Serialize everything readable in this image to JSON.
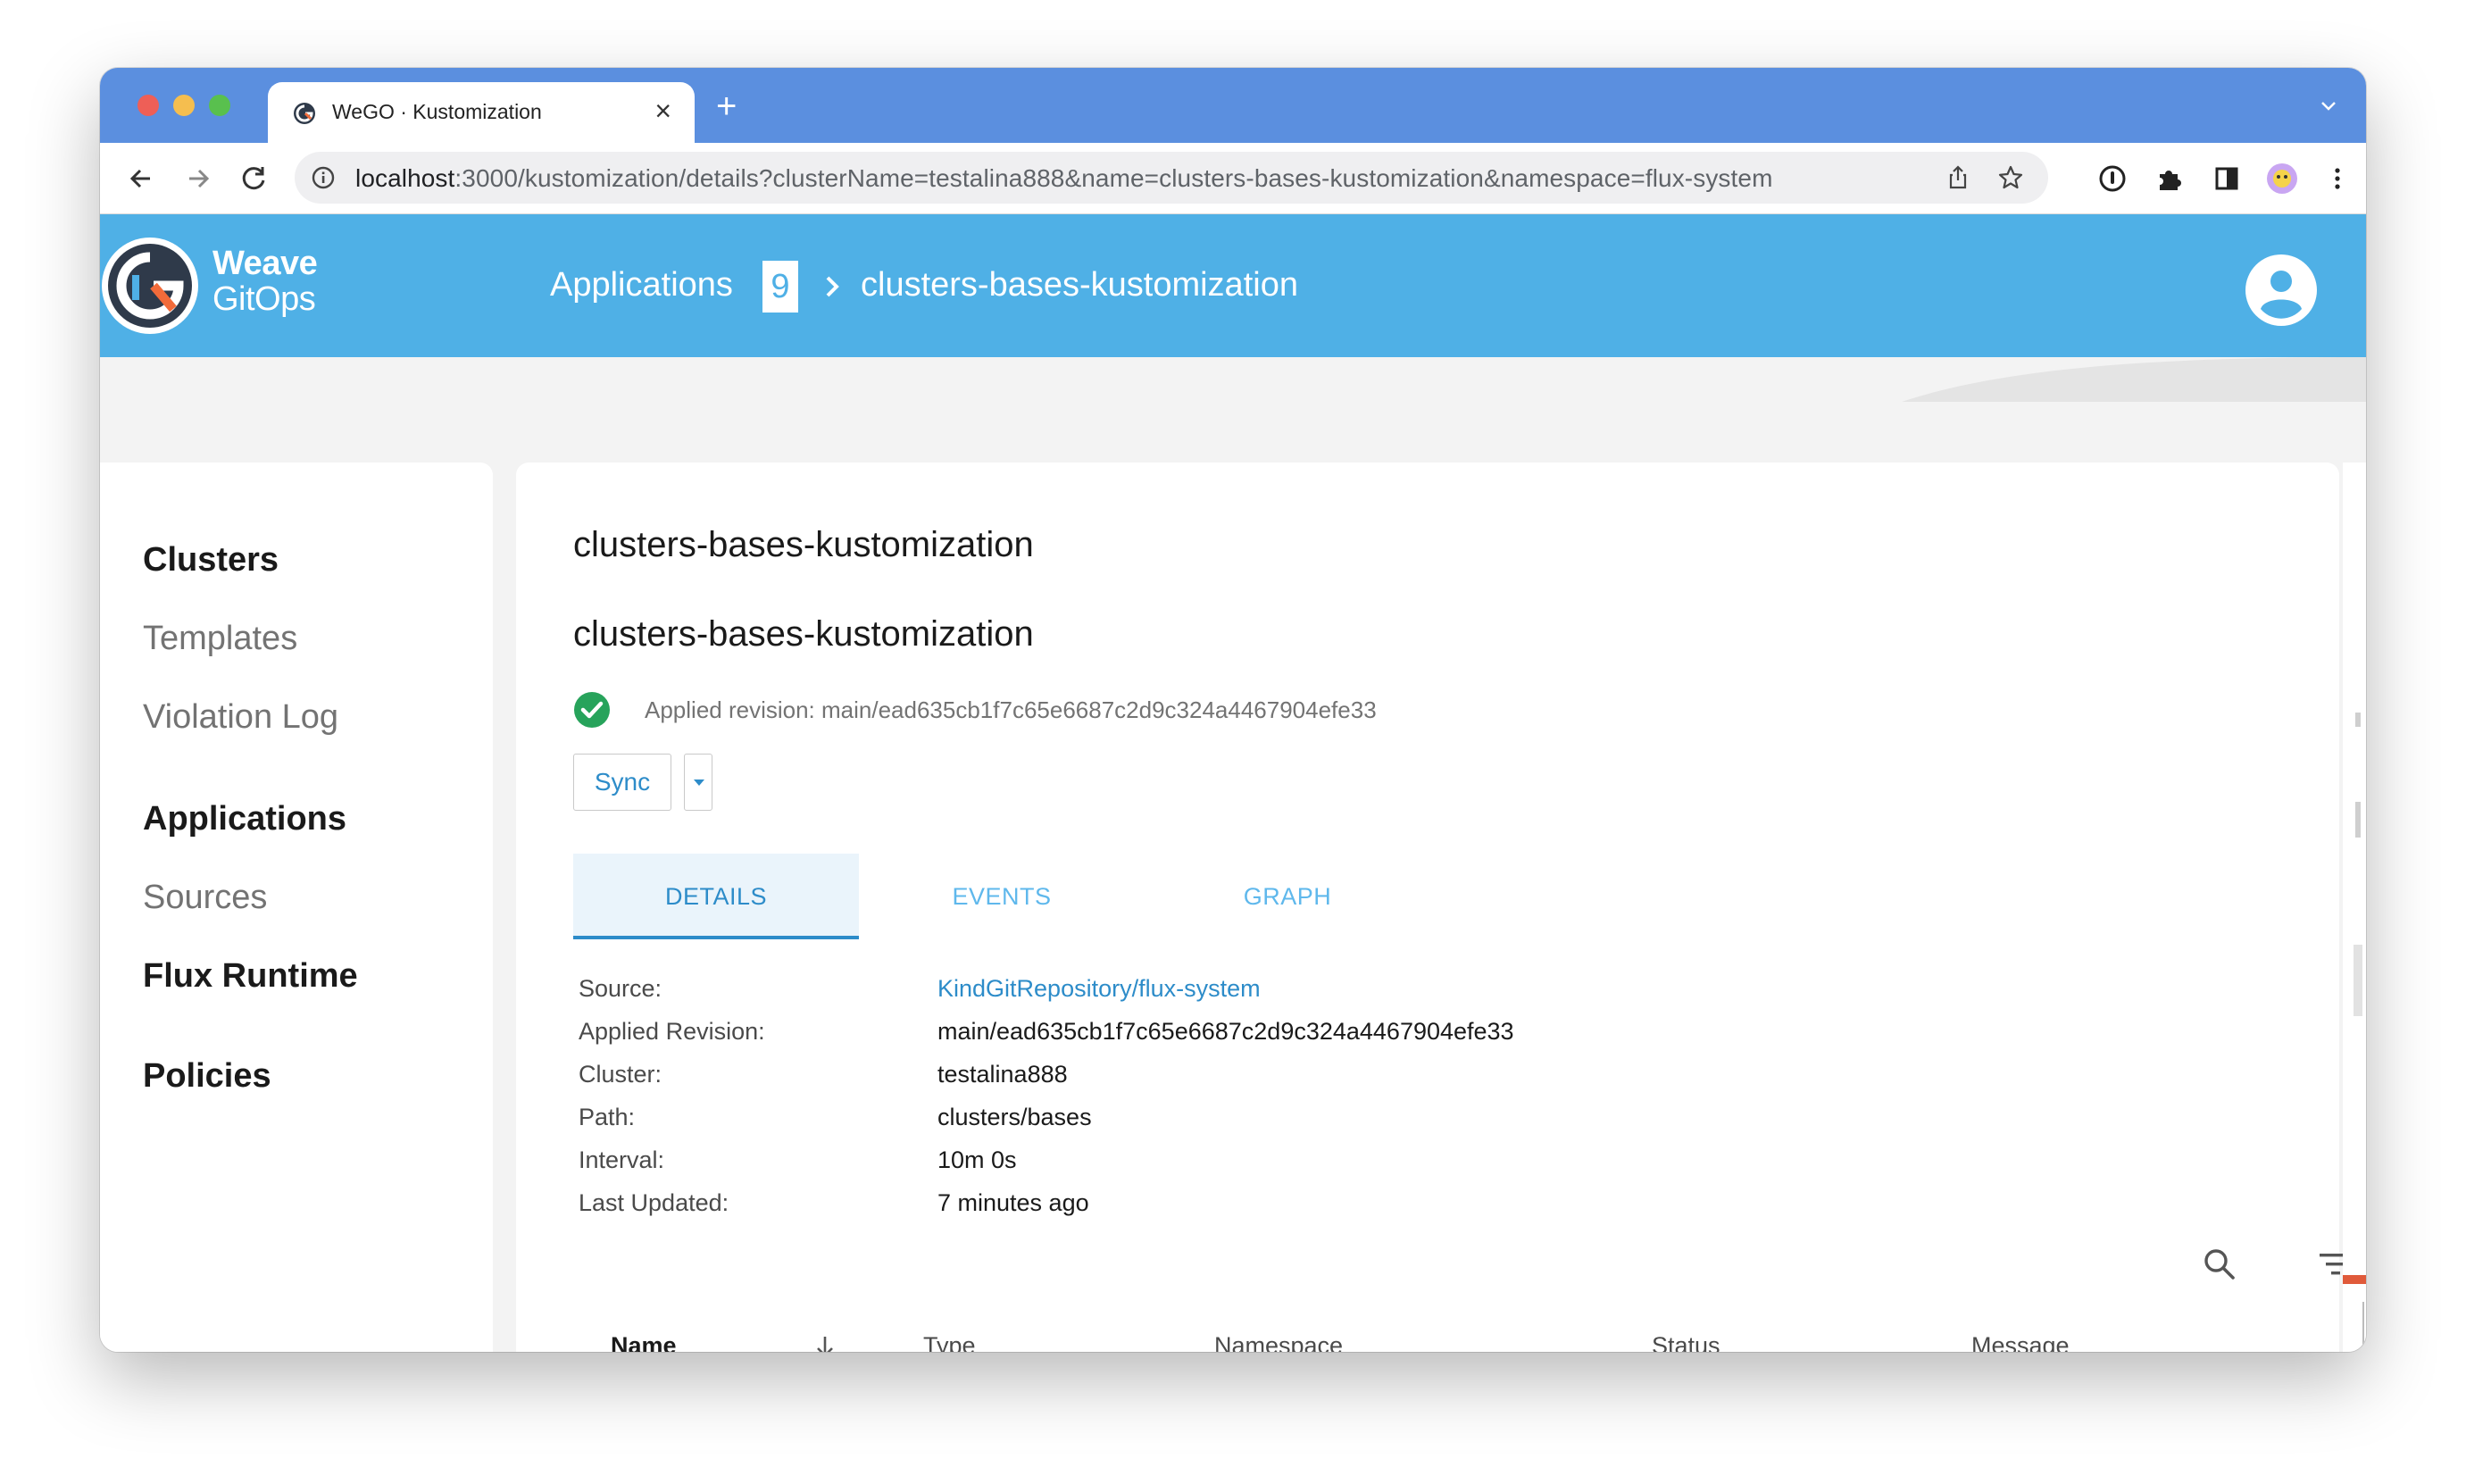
{
  "browser": {
    "tab_title": "WeGO · Kustomization",
    "url_host": "localhost",
    "url_rest": ":3000/kustomization/details?clusterName=testalina888&name=clusters-bases-kustomization&namespace=flux-system"
  },
  "header": {
    "logo_line1": "Weave",
    "logo_line2": "GitOps",
    "breadcrumb_parent": "Applications",
    "breadcrumb_count": "9",
    "breadcrumb_current": "clusters-bases-kustomization"
  },
  "sidebar": {
    "items": [
      {
        "label": "Clusters"
      },
      {
        "label": "Templates"
      },
      {
        "label": "Violation Log"
      },
      {
        "label": "Applications"
      },
      {
        "label": "Sources"
      },
      {
        "label": "Flux Runtime"
      },
      {
        "label": "Policies"
      }
    ]
  },
  "main": {
    "title": "clusters-bases-kustomization",
    "subtitle": "clusters-bases-kustomization",
    "status_text": "Applied revision: main/ead635cb1f7c65e6687c2d9c324a4467904efe33",
    "sync_label": "Sync",
    "tabs": [
      {
        "label": "DETAILS"
      },
      {
        "label": "EVENTS"
      },
      {
        "label": "GRAPH"
      }
    ],
    "details": [
      {
        "label": "Source:",
        "value": "KindGitRepository/flux-system"
      },
      {
        "label": "Applied Revision:",
        "value": "main/ead635cb1f7c65e6687c2d9c324a4467904efe33"
      },
      {
        "label": "Cluster:",
        "value": "testalina888"
      },
      {
        "label": "Path:",
        "value": "clusters/bases"
      },
      {
        "label": "Interval:",
        "value": "10m 0s"
      },
      {
        "label": "Last Updated:",
        "value": "7 minutes ago"
      }
    ],
    "table_columns": [
      {
        "label": "Name"
      },
      {
        "label": "Type"
      },
      {
        "label": "Namespace"
      },
      {
        "label": "Status"
      },
      {
        "label": "Message"
      }
    ]
  },
  "colors": {
    "header": "#4fb0e6",
    "tabstrip": "#5b8fdf",
    "accent": "#2d8cc9",
    "success": "#27a35b"
  }
}
